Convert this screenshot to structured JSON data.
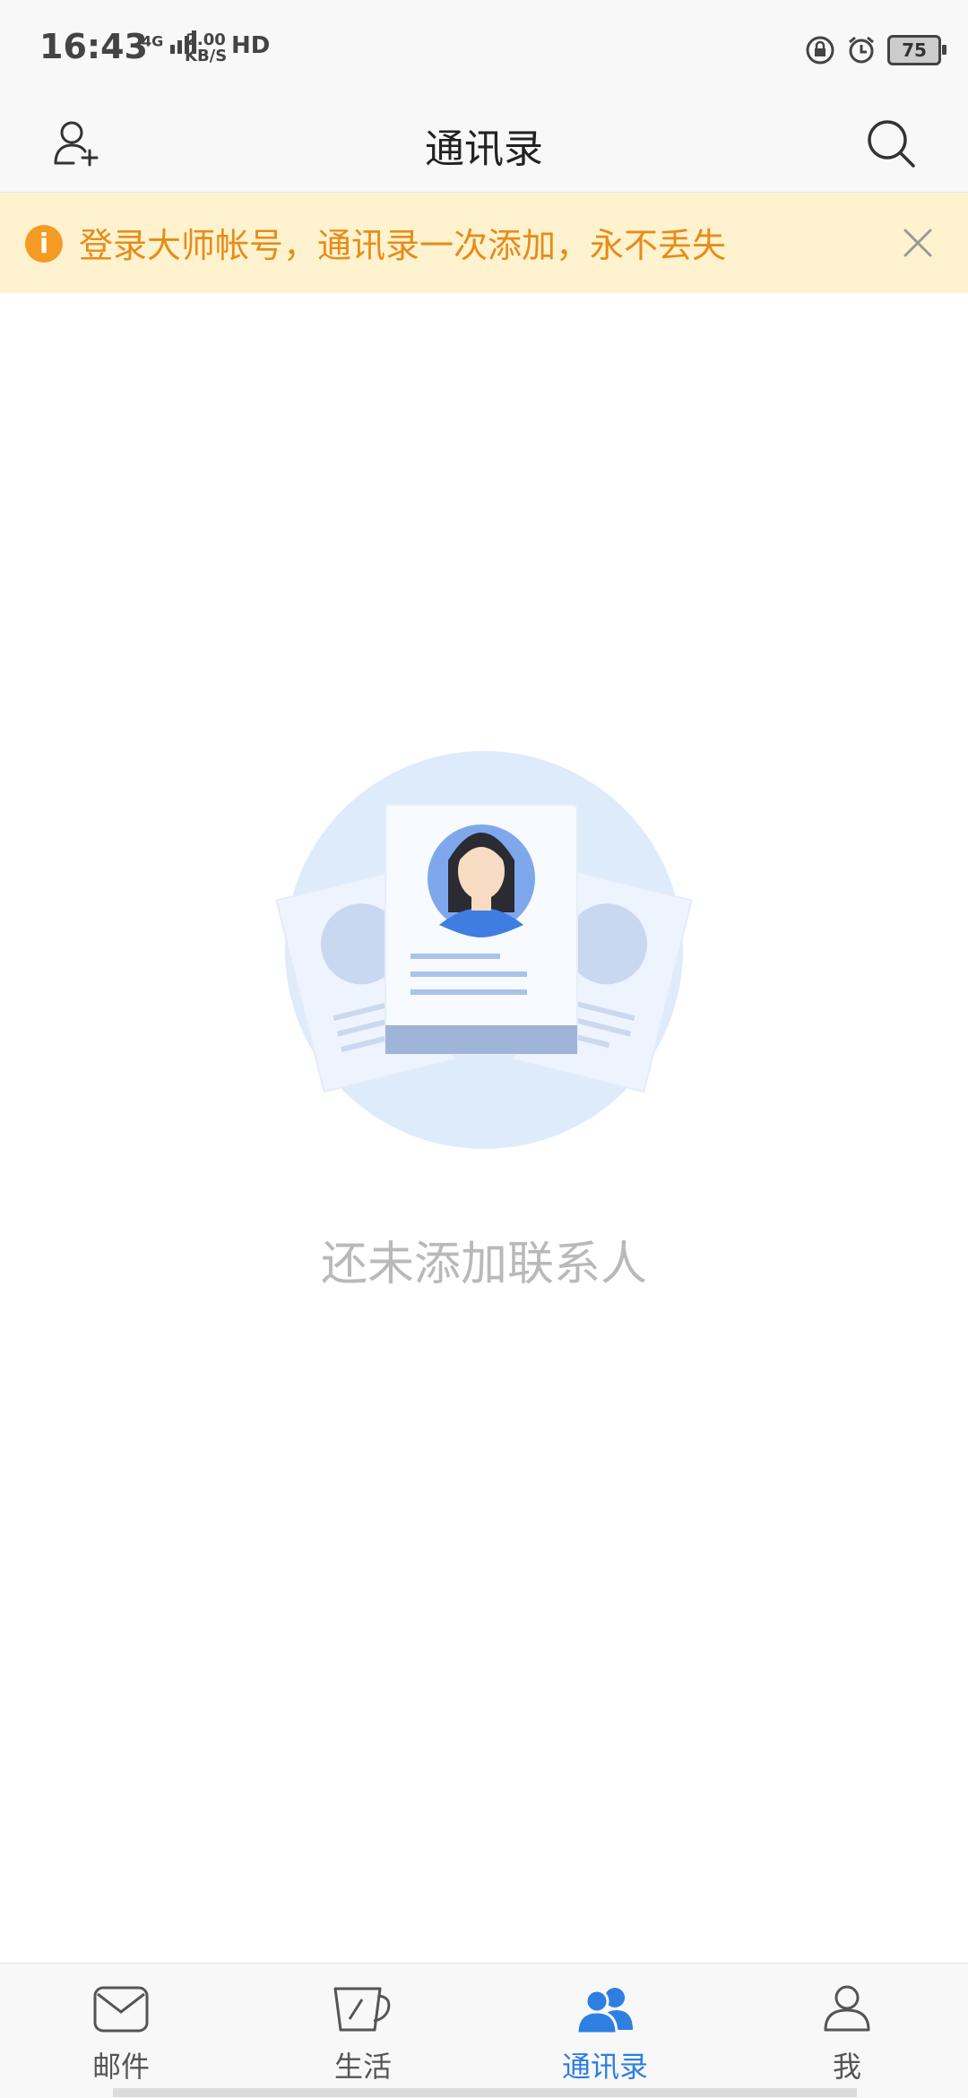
{
  "status_bar": {
    "time": "16:43",
    "network": "4G",
    "speed_value": "2.00",
    "speed_unit": "KB/S",
    "hd": "HD",
    "battery": "75"
  },
  "header": {
    "title": "通讯录",
    "left_icon": "add-contact-icon",
    "right_icon": "search-icon"
  },
  "banner": {
    "text": "登录大师帐号，通讯录一次添加，永不丢失",
    "info_glyph": "i",
    "accent": "#f59a23",
    "background": "#fff3cf"
  },
  "empty_state": {
    "text": "还未添加联系人"
  },
  "bottom_nav": {
    "items": [
      {
        "label": "邮件",
        "icon": "mail-icon",
        "active": false
      },
      {
        "label": "生活",
        "icon": "cup-icon",
        "active": false
      },
      {
        "label": "通讯录",
        "icon": "contacts-icon",
        "active": true
      },
      {
        "label": "我",
        "icon": "profile-icon",
        "active": false
      }
    ],
    "active_color": "#2d7fe0"
  }
}
